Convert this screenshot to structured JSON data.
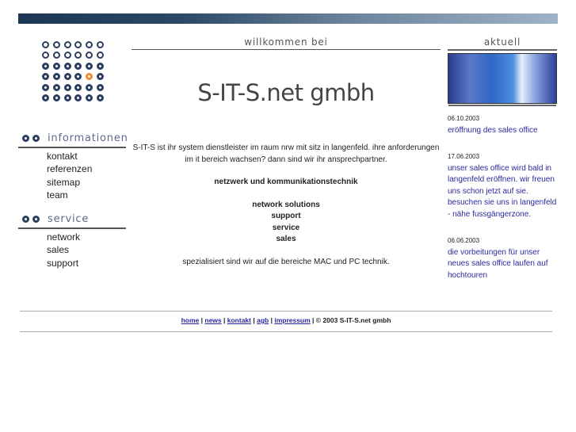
{
  "header": {
    "welcome": "willkommen bei",
    "brand": "S-IT-S.net gmbh",
    "news_title": "aktuell"
  },
  "sidebar": {
    "sections": [
      {
        "title": "informationen",
        "items": [
          "kontakt",
          "referenzen",
          "sitemap",
          "team"
        ]
      },
      {
        "title": "service",
        "items": [
          "network",
          "sales",
          "support"
        ]
      }
    ]
  },
  "main": {
    "intro": "S-IT-S ist ihr system dienstleister im raum nrw mit sitz in langenfeld. ihre anforderungen im it bereich wachsen? dann sind wir ihr ansprechpartner.",
    "headline": "netzwerk und kommunikationstechnik",
    "services": [
      "network solutions",
      "support",
      "service",
      "sales"
    ],
    "closing": "spezialisiert sind wir auf die bereiche MAC und PC technik."
  },
  "news": [
    {
      "date": "06.10.2003",
      "text": "eröffnung des sales office"
    },
    {
      "date": "17.06.2003",
      "text": "unser sales office wird bald in langenfeld eröffnen. wir freuen uns schon jetzt auf sie. besuchen sie uns in langenfeld - nähe fussgängerzone."
    },
    {
      "date": "06.06.2003",
      "text": "die vorbeitungen für unser neues sales office laufen auf hochtouren"
    }
  ],
  "footer": {
    "links": [
      "home",
      "news",
      "kontakt",
      "agb",
      "impressum"
    ],
    "copyright": "© 2003 S-IT-S.net gmbh"
  }
}
